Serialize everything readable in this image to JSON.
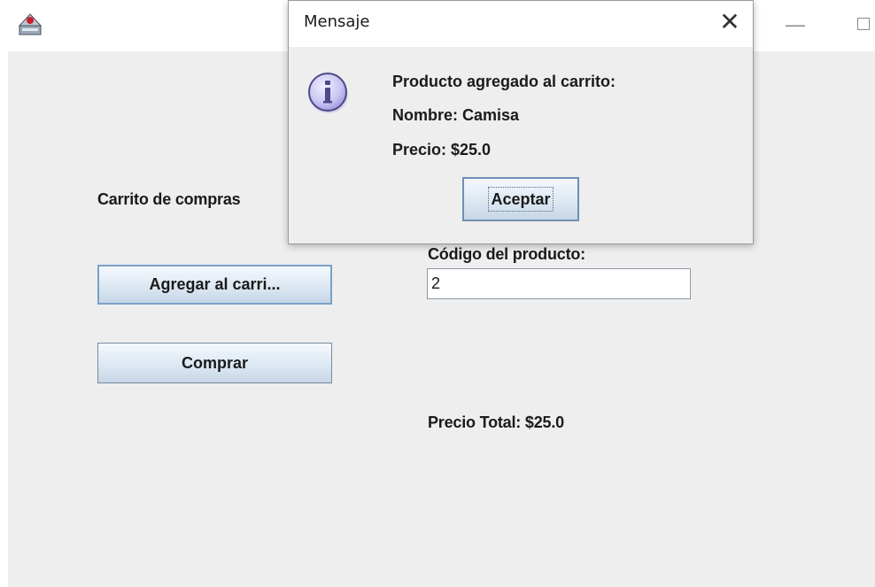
{
  "window": {
    "icon": "java-app-icon",
    "minimize_glyph": "—",
    "maximize_icon": "maximize-icon"
  },
  "main": {
    "cart_label": "Carrito de compras",
    "code_label": "Código del producto:",
    "code_value": "2",
    "add_button": "Agregar al carri...",
    "buy_button": "Comprar",
    "total_label": "Precio Total: $25.0"
  },
  "dialog": {
    "title": "Mensaje",
    "close_glyph": "✕",
    "icon": "info-icon",
    "lines": [
      "Producto agregado al carrito:",
      "Nombre: Camisa",
      "Precio: $25.0"
    ],
    "ok_button": "Aceptar"
  }
}
